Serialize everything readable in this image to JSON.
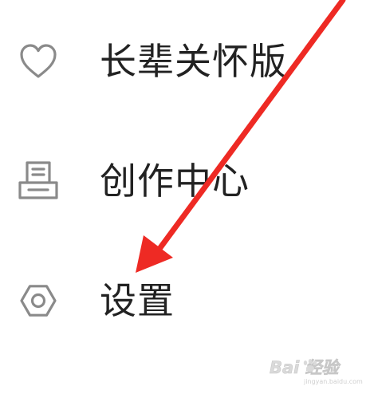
{
  "menu": {
    "items": [
      {
        "label": "长辈关怀版",
        "icon": "heart-icon"
      },
      {
        "label": "创作中心",
        "icon": "creator-center-icon"
      },
      {
        "label": "设置",
        "icon": "gear-icon"
      }
    ]
  },
  "annotation": {
    "arrow_color": "#ee2a24"
  },
  "watermark": {
    "text": "Bai 经验",
    "subtext": "jingyan.baidu.com"
  }
}
